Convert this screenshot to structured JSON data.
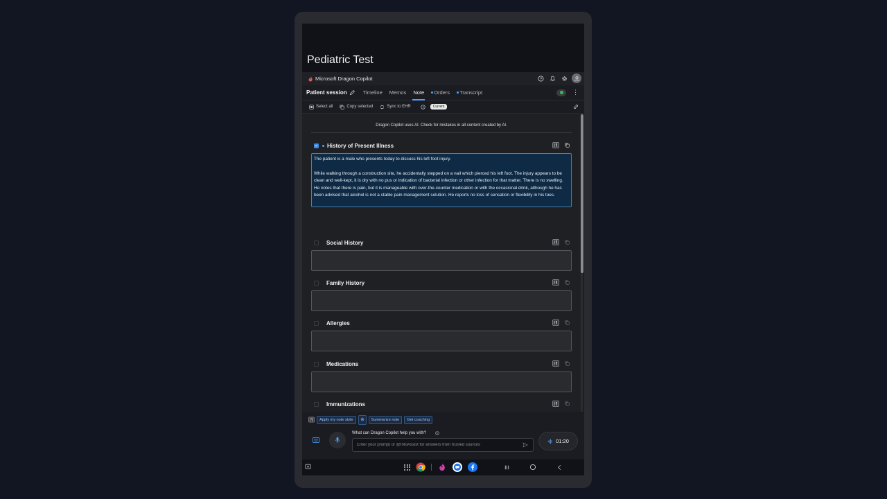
{
  "window": {
    "title": "Pediatric Test"
  },
  "app": {
    "name": "Microsoft Dragon Copilot"
  },
  "session": {
    "title": "Patient session",
    "tabs": [
      {
        "label": "Timeline",
        "active": false,
        "dot": false
      },
      {
        "label": "Memos",
        "active": false,
        "dot": false
      },
      {
        "label": "Note",
        "active": true,
        "dot": false
      },
      {
        "label": "Orders",
        "active": false,
        "dot": true
      },
      {
        "label": "Transcript",
        "active": false,
        "dot": true
      }
    ]
  },
  "toolbar": {
    "select_all": "Select all",
    "copy_selected": "Copy selected",
    "sync_to_ehr": "Sync to EHR",
    "current_badge": "Current"
  },
  "note": {
    "disclaimer": "Dragon Copilot uses AI. Check for mistakes in all content created by AI.",
    "hpi": {
      "title": "History of Present Illness",
      "paragraph_1": "The patient is a male who presents today to discuss his left foot injury.",
      "paragraph_2": "While walking through a construction site, he accidentally stepped on a nail which pierced his left foot. The injury appears to be clean and well-kept, it is dry with no pus or indication of bacterial infection or other infection for that matter. There is no swelling. He notes that there is pain, but it is manageable with over-the-counter medication or with the occasional drink, although he has been advised that alcohol is not a stable pain management solution. He reports no loss of sensation or flexibility in his toes."
    },
    "sections": [
      {
        "title": "Social History"
      },
      {
        "title": "Family History"
      },
      {
        "title": "Allergies"
      },
      {
        "title": "Medications"
      },
      {
        "title": "Immunizations"
      }
    ]
  },
  "actions": {
    "apply_style": "Apply my note style",
    "summarize": "Summarize note",
    "coaching": "Get coaching"
  },
  "prompt": {
    "label": "What can Dragon Copilot help you with?",
    "placeholder": "Enter your prompt or @InfoAssist for answers from trusted sources"
  },
  "recording": {
    "timer": "01:20"
  },
  "colors": {
    "accent": "#4da3ff",
    "hpi_bg": "#0e2a44",
    "rec_green": "#3fb950"
  }
}
